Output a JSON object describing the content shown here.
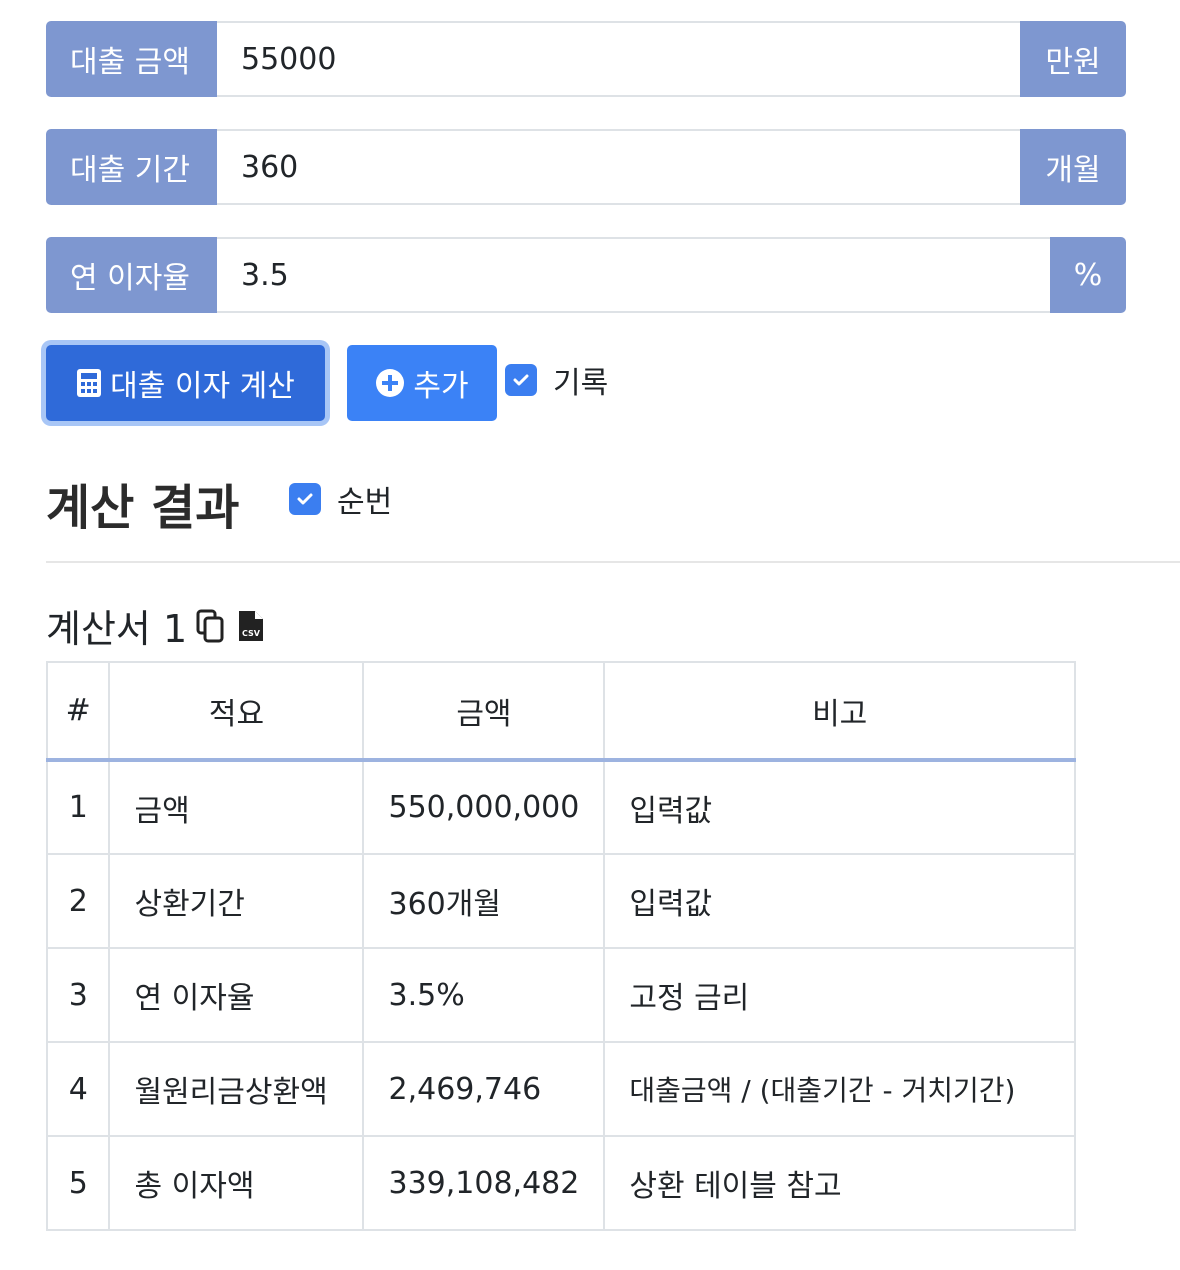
{
  "form": {
    "amount": {
      "label": "대출 금액",
      "value": "55000",
      "unit": "만원"
    },
    "period": {
      "label": "대출 기간",
      "value": "360",
      "unit": "개월"
    },
    "rate": {
      "label": "연 이자율",
      "value": "3.5",
      "unit": "%"
    }
  },
  "actions": {
    "calc_label": "대출 이자 계산",
    "add_label": "추가",
    "record_label": "기록",
    "record_checked": true
  },
  "result": {
    "title": "계산 결과",
    "serial_label": "순번",
    "serial_checked": true,
    "doc_title": "계산서 1",
    "columns": [
      "#",
      "적요",
      "금액",
      "비고"
    ],
    "rows": [
      {
        "no": "1",
        "item": "금액",
        "amount": "550,000,000",
        "note": "입력값"
      },
      {
        "no": "2",
        "item": "상환기간",
        "amount": "360개월",
        "note": "입력값"
      },
      {
        "no": "3",
        "item": "연 이자율",
        "amount": "3.5%",
        "note": "고정 금리"
      },
      {
        "no": "4",
        "item": "월원리금상환액",
        "amount": "2,469,746",
        "note": "대출금액 / (대출기간 - 거치기간)"
      },
      {
        "no": "5",
        "item": "총 이자액",
        "amount": "339,108,482",
        "note": "상환 테이블 참고"
      }
    ]
  },
  "colors": {
    "addon": "#7e97d0",
    "primary": "#2f6ad9",
    "add": "#3b82f6",
    "checkbox": "#3b7ef0"
  },
  "icons": [
    "calculator-icon",
    "plus-circle-icon",
    "check-icon",
    "copy-icon",
    "csv-file-icon"
  ]
}
